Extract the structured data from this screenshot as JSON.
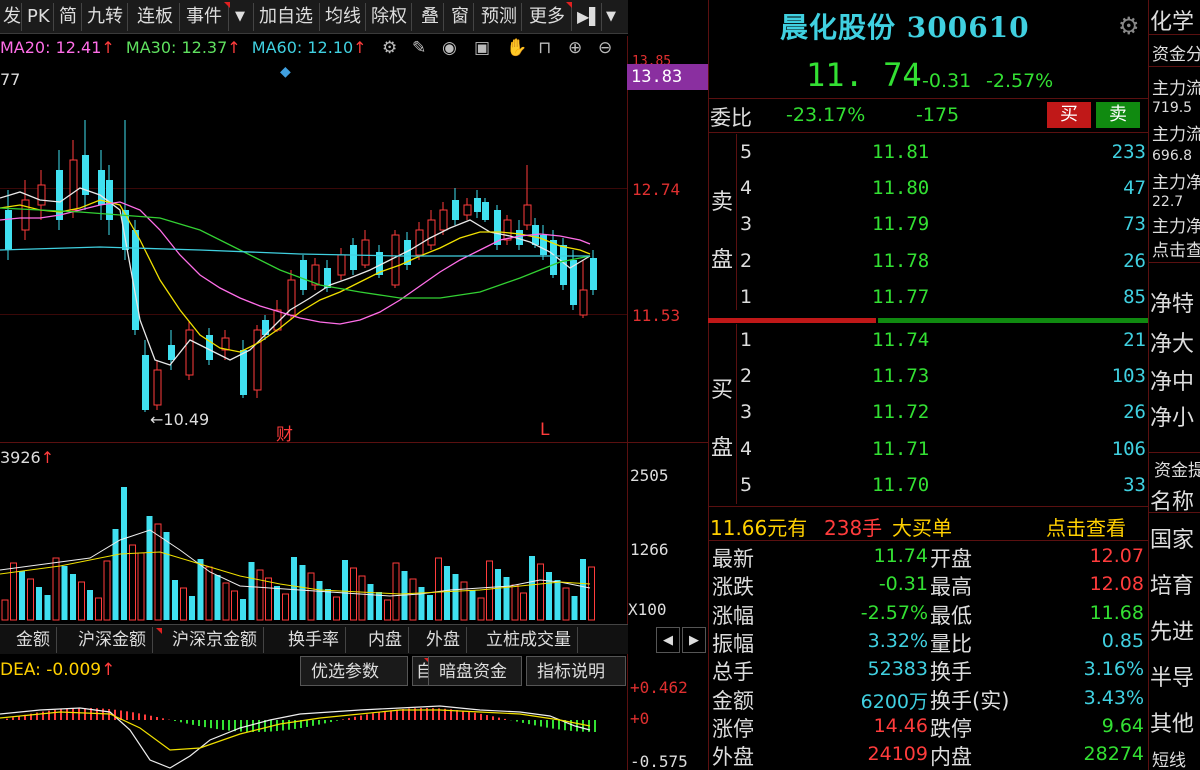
{
  "toolbar": {
    "items": [
      "发",
      "PK",
      "简",
      "九转",
      "连板",
      "事件",
      "加自选",
      "均线",
      "除权",
      "叠",
      "窗",
      "预测",
      "更多"
    ]
  },
  "ma": {
    "ma20": "MA20: 12.41",
    "ma30": "MA30: 12.37",
    "ma60": "MA60: 12.10",
    "arrow": "↑",
    "left_label": "77"
  },
  "price_axis": {
    "top": "13.85",
    "tag": "13.83",
    "mid": "12.74",
    "low": "11.53"
  },
  "chart_labels": {
    "low_marker": "10.49",
    "cai": "财",
    "L": "L"
  },
  "volume": {
    "label": "3926",
    "arrow": "↑",
    "top": "2505",
    "mid": "1266",
    "unit": "X100"
  },
  "sub_tabs": [
    "金额",
    "沪深金额",
    "沪深京金额",
    "换手率",
    "内盘",
    "外盘",
    "立桩成交量"
  ],
  "macd": {
    "dea": "DEA: -0.009",
    "arrow": "↑",
    "top": "+0.462",
    "zero": "+0",
    "bottom": "-0.575"
  },
  "macd_buttons": {
    "params": "优选参数",
    "cut": "自",
    "darkpool": "暗盘资金",
    "explain": "指标说明"
  },
  "stock": {
    "name": "晨化股份 300610",
    "price": "11. 74",
    "change": "-0.31",
    "pct": "-2.57%"
  },
  "weibi": {
    "label": "委比",
    "pct": "-23.17%",
    "diff": "-175",
    "buy": "买",
    "sell": "卖"
  },
  "sell_label": [
    "卖",
    "盘"
  ],
  "buy_label": [
    "买",
    "盘"
  ],
  "asks": [
    {
      "lvl": "5",
      "price": "11.81",
      "vol": "233"
    },
    {
      "lvl": "4",
      "price": "11.80",
      "vol": "47"
    },
    {
      "lvl": "3",
      "price": "11.79",
      "vol": "73"
    },
    {
      "lvl": "2",
      "price": "11.78",
      "vol": "26"
    },
    {
      "lvl": "1",
      "price": "11.77",
      "vol": "85"
    }
  ],
  "bids": [
    {
      "lvl": "1",
      "price": "11.74",
      "vol": "21"
    },
    {
      "lvl": "2",
      "price": "11.73",
      "vol": "103"
    },
    {
      "lvl": "3",
      "price": "11.72",
      "vol": "26"
    },
    {
      "lvl": "4",
      "price": "11.71",
      "vol": "106"
    },
    {
      "lvl": "5",
      "price": "11.70",
      "vol": "33"
    }
  ],
  "bigorder": {
    "price": "11.66元有",
    "qty": "238手",
    "label": "大买单",
    "link": "点击查看"
  },
  "stats": [
    {
      "k1": "最新",
      "v1": "11.74",
      "c1": "g",
      "k2": "开盘",
      "v2": "12.07",
      "c2": "r"
    },
    {
      "k1": "涨跌",
      "v1": "-0.31",
      "c1": "g",
      "k2": "最高",
      "v2": "12.08",
      "c2": "r"
    },
    {
      "k1": "涨幅",
      "v1": "-2.57%",
      "c1": "g",
      "k2": "最低",
      "v2": "11.68",
      "c2": "g"
    },
    {
      "k1": "振幅",
      "v1": "3.32%",
      "c1": "c",
      "k2": "量比",
      "v2": "0.85",
      "c2": "c"
    },
    {
      "k1": "总手",
      "v1": "52383",
      "c1": "c",
      "k2": "换手",
      "v2": "3.16%",
      "c2": "c"
    },
    {
      "k1": "金额",
      "v1": "6200万",
      "c1": "c",
      "k2": "换手(实)",
      "v2": "3.43%",
      "c2": "c"
    },
    {
      "k1": "涨停",
      "v1": "14.46",
      "c1": "r",
      "k2": "跌停",
      "v2": "9.64",
      "c2": "g"
    },
    {
      "k1": "外盘",
      "v1": "24109",
      "c1": "r",
      "k2": "内盘",
      "v2": "28274",
      "c2": "g"
    }
  ],
  "side": {
    "title": "化学",
    "zijin": "资金分",
    "zl1": "主力流",
    "zl1v": "719.5",
    "zl2": "主力流",
    "zl2v": "696.8",
    "zl3": "主力净",
    "zl3v": "22.7",
    "zl4": "主力净",
    "link": "点击查",
    "net1": "净特",
    "net2": "净大",
    "net3": "净中",
    "net4": "净小",
    "zjbox": "资金提",
    "mc": "名称",
    "i1": "国家",
    "i2": "培育",
    "i3": "先进",
    "i4": "半导",
    "i5": "其他",
    "bottom": "短线"
  },
  "colors": {
    "up": "#ff3c3c",
    "down": "#33e033",
    "cyan": "#40d0e0",
    "yellow": "#ffd000"
  }
}
